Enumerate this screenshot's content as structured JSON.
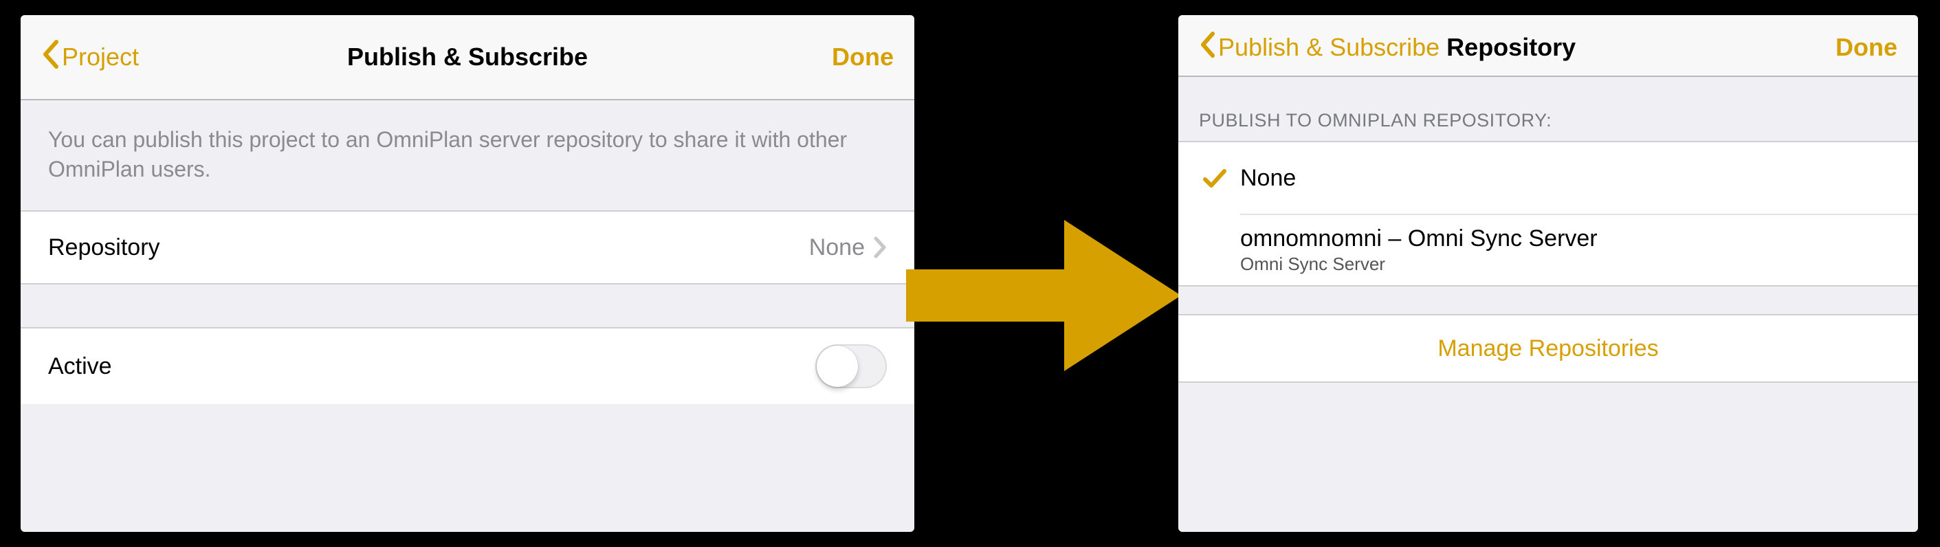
{
  "colors": {
    "accent": "#d6a000"
  },
  "left": {
    "back_label": "Project",
    "title": "Publish & Subscribe",
    "done_label": "Done",
    "description": "You can publish this project to an OmniPlan server repository to share it with other OmniPlan users.",
    "repo_row": {
      "label": "Repository",
      "value": "None"
    },
    "active_row": {
      "label": "Active",
      "on": false
    }
  },
  "right": {
    "back_label": "Publish & Subscribe",
    "title": "Repository",
    "done_label": "Done",
    "section_header": "PUBLISH TO OMNIPLAN REPOSITORY:",
    "options": [
      {
        "label": "None",
        "sublabel": "",
        "selected": true
      },
      {
        "label": "omnomnomni – Omni Sync Server",
        "sublabel": "Omni Sync Server",
        "selected": false
      }
    ],
    "manage_label": "Manage Repositories"
  }
}
